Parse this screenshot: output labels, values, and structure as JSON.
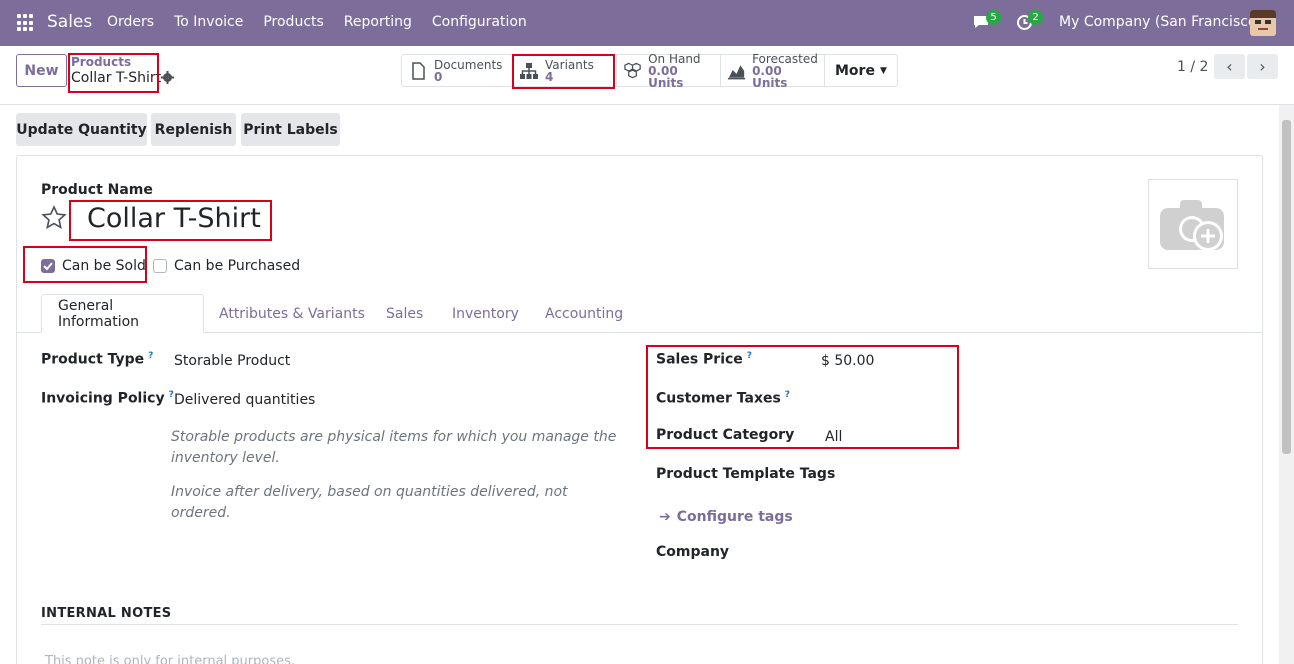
{
  "navbar": {
    "app_name": "Sales",
    "menu": [
      "Orders",
      "To Invoice",
      "Products",
      "Reporting",
      "Configuration"
    ],
    "messages_count": "5",
    "activities_count": "2",
    "company": "My Company (San Francisco)"
  },
  "control": {
    "new_label": "New",
    "breadcrumb_parent": "Products",
    "breadcrumb_current": "Collar T-Shirt",
    "smart_buttons": [
      {
        "label": "Documents",
        "value": "0"
      },
      {
        "label": "Variants",
        "value": "4"
      },
      {
        "label": "On Hand",
        "value": "0.00 Units"
      },
      {
        "label": "Forecasted",
        "value": "0.00 Units"
      }
    ],
    "more_label": "More",
    "pager": "1 / 2"
  },
  "actions": [
    "Update Quantity",
    "Replenish",
    "Print Labels"
  ],
  "form": {
    "name_label": "Product Name",
    "name_value": "Collar T-Shirt",
    "can_be_sold_label": "Can be Sold",
    "can_be_sold_checked": true,
    "can_be_purchased_label": "Can be Purchased",
    "can_be_purchased_checked": false,
    "tabs": [
      "General Information",
      "Attributes & Variants",
      "Sales",
      "Inventory",
      "Accounting"
    ],
    "product_type_label": "Product Type",
    "product_type_value": "Storable Product",
    "invoicing_policy_label": "Invoicing Policy",
    "invoicing_policy_value": "Delivered quantities",
    "note_storable": "Storable products are physical items for which you manage the inventory level.",
    "note_invoice": "Invoice after delivery, based on quantities delivered, not ordered.",
    "sales_price_label": "Sales Price",
    "sales_price_value": "$ 50.00",
    "customer_taxes_label": "Customer Taxes",
    "product_category_label": "Product Category",
    "product_category_value": "All",
    "template_tags_label": "Product Template Tags",
    "configure_tags_label": "Configure tags",
    "company_label": "Company",
    "internal_notes_label": "INTERNAL NOTES",
    "internal_notes_placeholder": "This note is only for internal purposes."
  },
  "colors": {
    "brand": "#7c6d9a",
    "highlight": "#d9001b",
    "badge": "#28a745"
  }
}
